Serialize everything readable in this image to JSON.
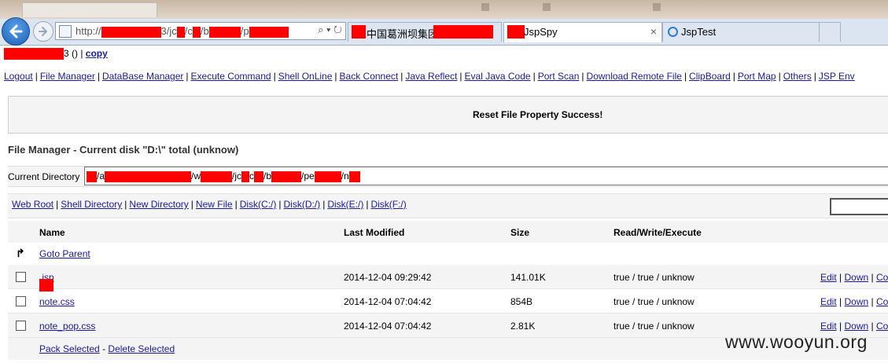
{
  "browser": {
    "url_prefix": "http://",
    "url_parts": [
      "3/jc",
      "/c",
      "/b",
      "/p"
    ],
    "tabs": [
      {
        "label": "中国葛洲坝集团"
      },
      {
        "label": "JspSpy",
        "close": "×"
      },
      {
        "label": "JspTest"
      }
    ],
    "address_tools": "⌕ ▾ ↻"
  },
  "user_line": {
    "suffix": "3 () |",
    "copy": "copy"
  },
  "nav": [
    "Logout",
    "File Manager",
    "DataBase Manager",
    "Execute Command",
    "Shell OnLine",
    "Back Connect",
    "Java Reflect",
    "Eval Java Code",
    "Port Scan",
    "Download Remote File",
    "ClipBoard",
    "Port Map",
    "Others",
    "JSP Env"
  ],
  "message": "Reset File Property Success!",
  "file_manager": {
    "title": "File Manager - Current disk \"D:\\\" total (unknow)",
    "current_dir_label": "Current Directory",
    "dir_parts": [
      "/a",
      "/w",
      "/jc",
      "c",
      "/b",
      "/pe",
      "/n"
    ],
    "quick_links": [
      "Web Root",
      "Shell Directory",
      "New Directory",
      "New File",
      "Disk(C:/)",
      "Disk(D:/)",
      "Disk(E:/)",
      "Disk(F:/)"
    ],
    "columns": [
      "Name",
      "Last Modified",
      "Size",
      "Read/Write/Execute"
    ],
    "goto_parent": "Goto Parent",
    "goto_parent_icon": "↱",
    "files": [
      {
        "name": ".jsp",
        "modified": "2014-12-04 09:29:42",
        "size": "141.01K",
        "rwx": "true / true / unknow"
      },
      {
        "name": "note.css",
        "modified": "2014-12-04 07:04:42",
        "size": "854B",
        "rwx": "true / true / unknow"
      },
      {
        "name": "note_pop.css",
        "modified": "2014-12-04 07:04:42",
        "size": "2.81K",
        "rwx": "true / true / unknow"
      }
    ],
    "actions": {
      "edit": "Edit",
      "down": "Down",
      "co": "Co"
    },
    "footer": {
      "pack": "Pack Selected",
      "delete": "Delete Selected",
      "dash": "-"
    }
  },
  "watermark": "www.wooyun.org",
  "colors": {
    "redaction": "#ff0000",
    "link": "#1a1a9e",
    "panel": "#f4f4f4"
  }
}
